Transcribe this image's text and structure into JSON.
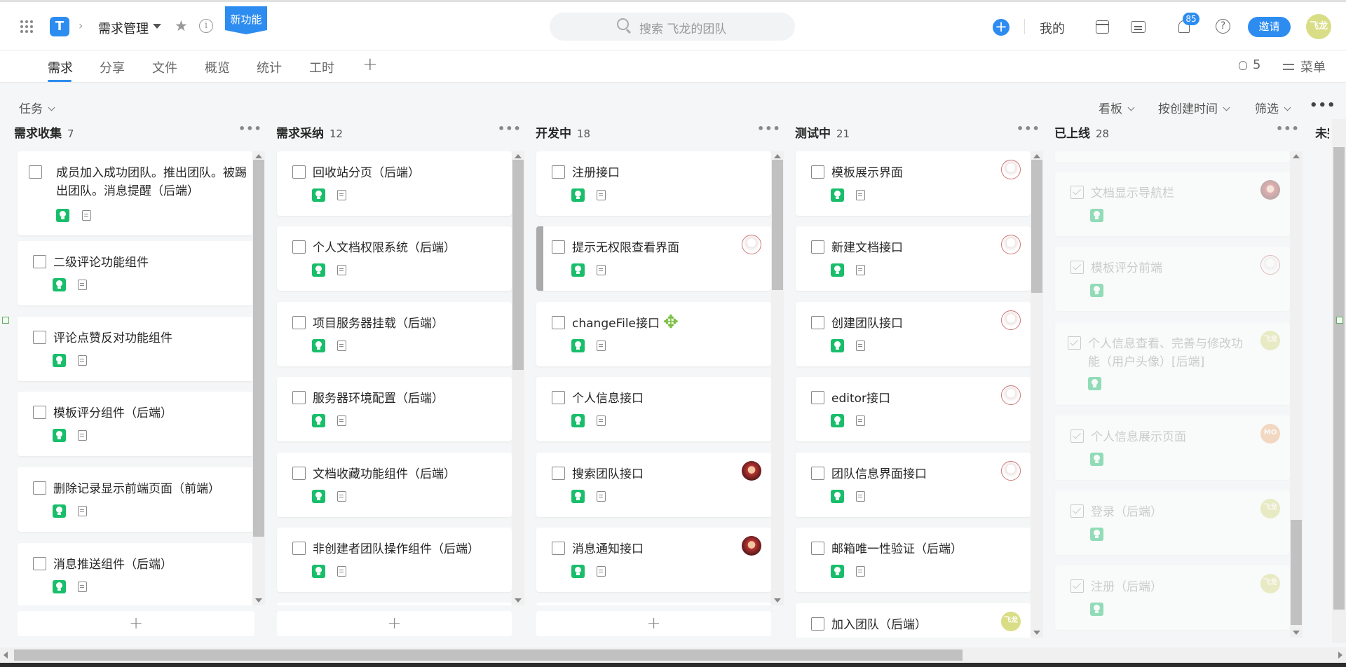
{
  "header": {
    "project_name": "需求管理",
    "new_feature_tag": "新功能",
    "search_placeholder": "搜索 飞龙的团队",
    "mine_label": "我的",
    "notification_count": "85",
    "invite_label": "邀请",
    "user_avatar_text": "飞龙",
    "logo_text": "T"
  },
  "tabs": {
    "items": [
      "需求",
      "分享",
      "文件",
      "概览",
      "统计",
      "工时"
    ],
    "active": "需求",
    "member_count": "5",
    "menu_label": "菜单"
  },
  "toolbar": {
    "view_filter": "任务",
    "view_mode": "看板",
    "sort": "按创建时间",
    "filter": "筛选"
  },
  "columns": [
    {
      "name": "需求收集",
      "count": "7",
      "cards": [
        {
          "title": "成员加入成功团队。推出团队。被踢出团队。消息提醒（后端）"
        },
        {
          "title": "二级评论功能组件"
        },
        {
          "title": "评论点赞反对功能组件"
        },
        {
          "title": "模板评分组件（后端）"
        },
        {
          "title": "删除记录显示前端页面（前端）"
        },
        {
          "title": "消息推送组件（后端）"
        }
      ]
    },
    {
      "name": "需求采纳",
      "count": "12",
      "cards": [
        {
          "title": "回收站分页（后端）"
        },
        {
          "title": "个人文档权限系统（后端）"
        },
        {
          "title": "项目服务器挂载（后端）"
        },
        {
          "title": "服务器环境配置（后端）"
        },
        {
          "title": "文档收藏功能组件（后端）"
        },
        {
          "title": "非创建者团队操作组件（后端）"
        }
      ]
    },
    {
      "name": "开发中",
      "count": "18",
      "cards": [
        {
          "title": "注册接口"
        },
        {
          "title": "提示无权限查看界面"
        },
        {
          "title": "changeFile接口"
        },
        {
          "title": "个人信息接口"
        },
        {
          "title": "搜索团队接口"
        },
        {
          "title": "消息通知接口"
        }
      ]
    },
    {
      "name": "测试中",
      "count": "21",
      "cards": [
        {
          "title": "模板展示界面"
        },
        {
          "title": "新建文档接口"
        },
        {
          "title": "创建团队接口"
        },
        {
          "title": "editor接口"
        },
        {
          "title": "团队信息界面接口"
        },
        {
          "title": "邮箱唯一性验证（后端）"
        },
        {
          "title": "加入团队（后端）",
          "avatar": "飞龙"
        }
      ]
    },
    {
      "name": "已上线",
      "count": "28",
      "cards": [
        {
          "title": "文档显示导航栏"
        },
        {
          "title": "模板评分前端"
        },
        {
          "title": "个人信息查看、完善与修改功能（用户头像）[后端]",
          "avatar": "飞龙"
        },
        {
          "title": "个人信息展示页面",
          "avatar": "MO"
        },
        {
          "title": "登录（后端）",
          "avatar": "飞龙"
        },
        {
          "title": "注册（后端）",
          "avatar": "飞龙"
        }
      ]
    },
    {
      "name": "未完"
    }
  ],
  "colors": {
    "accent": "#2d8cf0",
    "tag_green": "#19be6b"
  },
  "icons": [
    "apps-grid-icon",
    "star-icon",
    "info-icon",
    "search-icon",
    "calendar-icon",
    "message-icon",
    "bell-icon",
    "help-icon",
    "lightbulb-icon",
    "document-icon",
    "move-icon"
  ]
}
